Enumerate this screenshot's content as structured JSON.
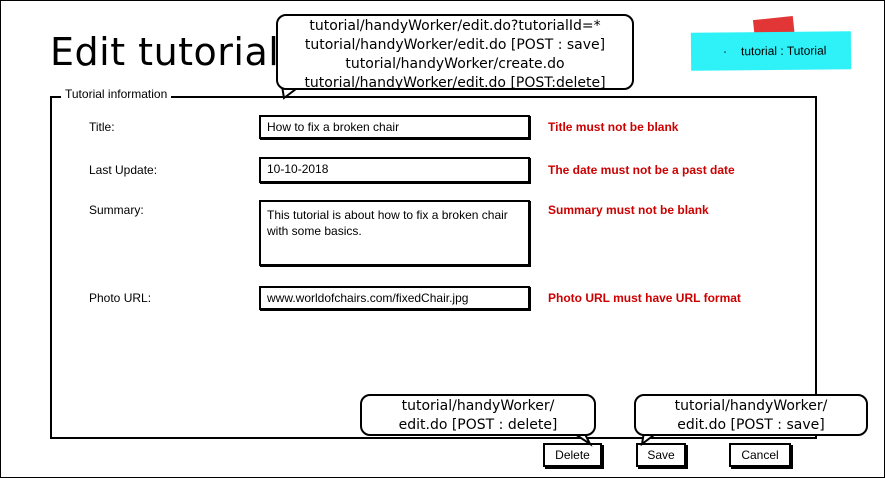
{
  "page": {
    "title": "Edit tutorial"
  },
  "sticky_note": {
    "bullet": "·",
    "text": "tutorial : Tutorial",
    "color": "#2ef2f7",
    "tape_color": "#e02a2a"
  },
  "form": {
    "legend": "Tutorial information",
    "fields": {
      "title": {
        "label": "Title:",
        "value": "How to fix a broken chair",
        "error": "Title must not be blank"
      },
      "last_update": {
        "label": "Last Update:",
        "value": "10-10-2018",
        "error": "The date must not be a past date"
      },
      "summary": {
        "label": "Summary:",
        "value": "This tutorial is about how to fix a broken chair with some basics.",
        "error": "Summary must not be blank"
      },
      "photo_url": {
        "label": "Photo URL:",
        "value": "www.worldofchairs.com/fixedChair.jpg",
        "error": "Photo URL must have URL format"
      }
    },
    "error_color": "#cc0000"
  },
  "buttons": {
    "delete": "Delete",
    "save": "Save",
    "cancel": "Cancel"
  },
  "callouts": {
    "top": {
      "line1": "tutorial/handyWorker/edit.do?tutorialId=*",
      "line2": "tutorial/handyWorker/edit.do [POST : save]",
      "line3": "tutorial/handyWorker/create.do",
      "line4": "tutorial/handyWorker/edit.do [POST:delete]"
    },
    "delete": {
      "line1": "tutorial/handyWorker/",
      "line2": "edit.do [POST : delete]"
    },
    "save": {
      "line1": "tutorial/handyWorker/",
      "line2": "edit.do [POST : save]"
    }
  }
}
